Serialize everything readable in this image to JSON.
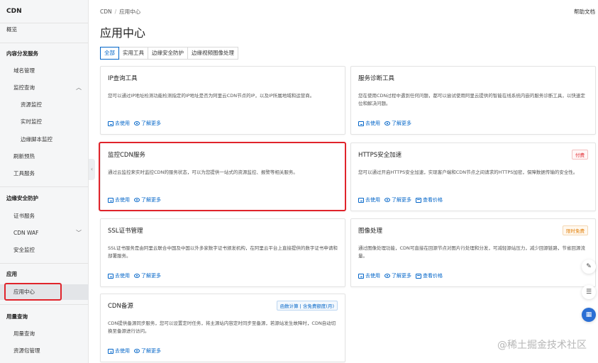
{
  "sidebar": {
    "title": "CDN",
    "overview": "概览",
    "groups": {
      "content": "内容分发服务",
      "edge_security": "边缘安全防护",
      "apps": "应用",
      "usage": "用量查询"
    },
    "items": {
      "domain_mgmt": "域名管理",
      "monitor_query": "监控查询",
      "resource_monitor": "资源监控",
      "realtime_monitor": "实时监控",
      "edge_script_monitor": "边缘脚本监控",
      "refresh_preload": "刷新预热",
      "toolbox": "工具服务",
      "cert_service": "证书服务",
      "cdn_waf": "CDN WAF",
      "security_monitor": "安全监控",
      "app_center": "应用中心",
      "usage_query": "用量查询",
      "resource_pack": "资源包管理"
    }
  },
  "header": {
    "breadcrumb_root": "CDN",
    "breadcrumb_sep": "/",
    "breadcrumb_current": "应用中心",
    "help": "帮助文档",
    "title": "应用中心"
  },
  "tabs": [
    "全部",
    "实用工具",
    "边缘安全防护",
    "边缘视频图像处理"
  ],
  "actions": {
    "use": "去使用",
    "learn": "了解更多",
    "price": "查看价格"
  },
  "cards": {
    "ip_query": {
      "title": "IP查询工具",
      "desc": "您可以通过IP地址检测功能检测指定的IP地址是否为阿里云CDN节点的IP，以及IP所属地域和运营商。"
    },
    "diagnosis": {
      "title": "服务诊断工具",
      "desc": "您在使用CDN过程中遇到任何问题，都可以尝试使用阿里云提供的智能在线系统内嵌的服务诊断工具，以快速定位和解决问题。"
    },
    "monitor": {
      "title": "监控CDN服务",
      "desc": "通过云监控来实时监控CDN的服务状态，可以为您提供一站式的资源监控、报警等相关服务。"
    },
    "https": {
      "title": "HTTPS安全加速",
      "badge": "付费",
      "desc": "您可以通过开启HTTPS安全加速，实现客户端和CDN节点之间请求的HTTPS加密，保障数据传输的安全性。"
    },
    "ssl": {
      "title": "SSL证书管理",
      "desc": "SSL证书服务是由阿里云联合中国及中国以外多家数字证书颁发机构，在阿里云平台上直接提供的数字证书申请和部署服务。"
    },
    "image": {
      "title": "图像处理",
      "badge": "限时免费",
      "desc": "通过图像处理功能，CDN可直接在回源节点对图片行处理和分发，可减轻源站压力，减少回源链路，节省回源流量。"
    },
    "backup": {
      "title": "CDN备源",
      "badge": "函数计算 | 含免费额度(月)",
      "desc": "CDN提供备源同步服务，您可以设置定时任务，将主源站内容定时同步至备源，若源站发生故障时，CDN自动切换至备源进行访问。"
    }
  },
  "float": {
    "edit": "✎",
    "chat": "☰",
    "apps": "▦"
  },
  "watermark": "@稀土掘金技术社区",
  "colors": {
    "accent": "#0064c8",
    "highlight": "#e0242b"
  }
}
